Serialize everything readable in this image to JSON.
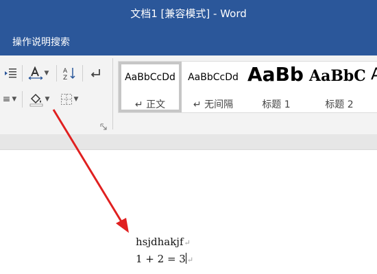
{
  "window": {
    "title": "文档1 [兼容模式]  -  Word"
  },
  "tell_me": {
    "label": "操作说明搜索"
  },
  "ribbon": {
    "styles": [
      {
        "sample": "AaBbCcDd",
        "name": "↵ 正文"
      },
      {
        "sample": "AaBbCcDd",
        "name": "↵ 无间隔"
      },
      {
        "sample": "AaBb",
        "name": "标题 1"
      },
      {
        "sample": "AaBbC",
        "name": "标题 2"
      },
      {
        "sample": "A",
        "name": ""
      }
    ],
    "icons": {
      "indent": "increase-indent-icon",
      "char_spacing": "character-spacing-icon",
      "sort": "sort-az-icon",
      "show_marks": "show-formatting-marks-icon",
      "align": "align-icon",
      "shading": "paint-bucket-shading-icon",
      "borders": "borders-icon",
      "launcher": "dialog-launcher-icon"
    }
  },
  "document": {
    "lines": [
      {
        "text": "hsjdhakjf"
      },
      {
        "text": "1 + 2 = 3"
      }
    ],
    "pilcrow": "↵"
  },
  "annotation": {
    "color": "#e02020"
  }
}
